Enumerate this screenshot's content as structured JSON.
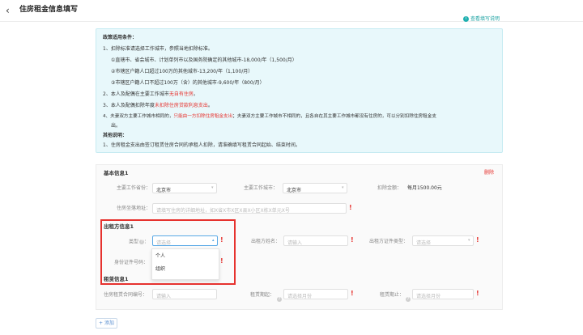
{
  "header": {
    "back_icon": "‹",
    "title": "住房租金信息填写"
  },
  "guide_link": {
    "icon": "info-icon",
    "label": "查看填写说明"
  },
  "policy": {
    "heading": "政策适用条件：",
    "line1": "1、扣除标准请选择工作城市，参照当地扣除标准。",
    "line1a": "①直辖市、省会城市、计划单列市以及国务院确定的其他城市-18,000/年（1,500/月）",
    "line1b": "②市辖区户籍人口超过100万的其他城市-13,200/年（1,100/月）",
    "line1c": "③市辖区户籍人口不超过100万（含）的其他城市-9,600/年（800/月）",
    "line2_pre": "2、本人及配偶在主要工作城市",
    "line2_red": "无自有住房",
    "line2_post": "。",
    "line3_pre": "3、本人及配偶扣除年度",
    "line3_red": "未扣除住房贷款利息支出",
    "line3_post": "。",
    "line4_pre": "4、夫妻双方主要工作城市相同的，",
    "line4_red": "只能由一方扣除住房租金支出",
    "line4_post": "；夫妻双方主要工作城市不相同的，且各自在其主要工作城市都没有住房的，可以分别扣除住房租金支",
    "line4_cont": "出。",
    "other_heading": "其他说明：",
    "other_line1": "1、住房租金支出由签订租赁住房合同的承租人扣除，请准确填写租赁合同起始、结束时间。"
  },
  "form": {
    "basic_title": "基本信息1",
    "delete_label": "删除",
    "province_label": "主要工作省份：",
    "province_value": "北京市",
    "city_label": "主要工作城市：",
    "city_value": "北京市",
    "standard_label": "扣除金额：",
    "standard_value": "每月1500.00元",
    "address_label": "住房坐落地址：",
    "address_placeholder": "请填写住房的详细地址，如X省X市X区X县X小区X栋X单元X号",
    "lessor_title": "出租方信息1",
    "type_label": "类型",
    "type_placeholder": "请选择",
    "lessor_name_label": "出租方姓名：",
    "lessor_name_placeholder": "请输入",
    "lessor_id_type_label": "出租方证件类型：",
    "lessor_id_type_placeholder": "请选择",
    "id_number_label": "身份证件号码：",
    "dropdown_options": [
      "个人",
      "组织"
    ],
    "lease_title": "租赁信息1",
    "contract_label": "住房租赁合同编号：",
    "contract_placeholder": "请输入",
    "start_label": "租赁期起：",
    "start_placeholder": "请选择月份",
    "end_label": "租赁期止：",
    "end_placeholder": "请选择月份",
    "required_mark": "!"
  },
  "add_button": "+ 添加"
}
